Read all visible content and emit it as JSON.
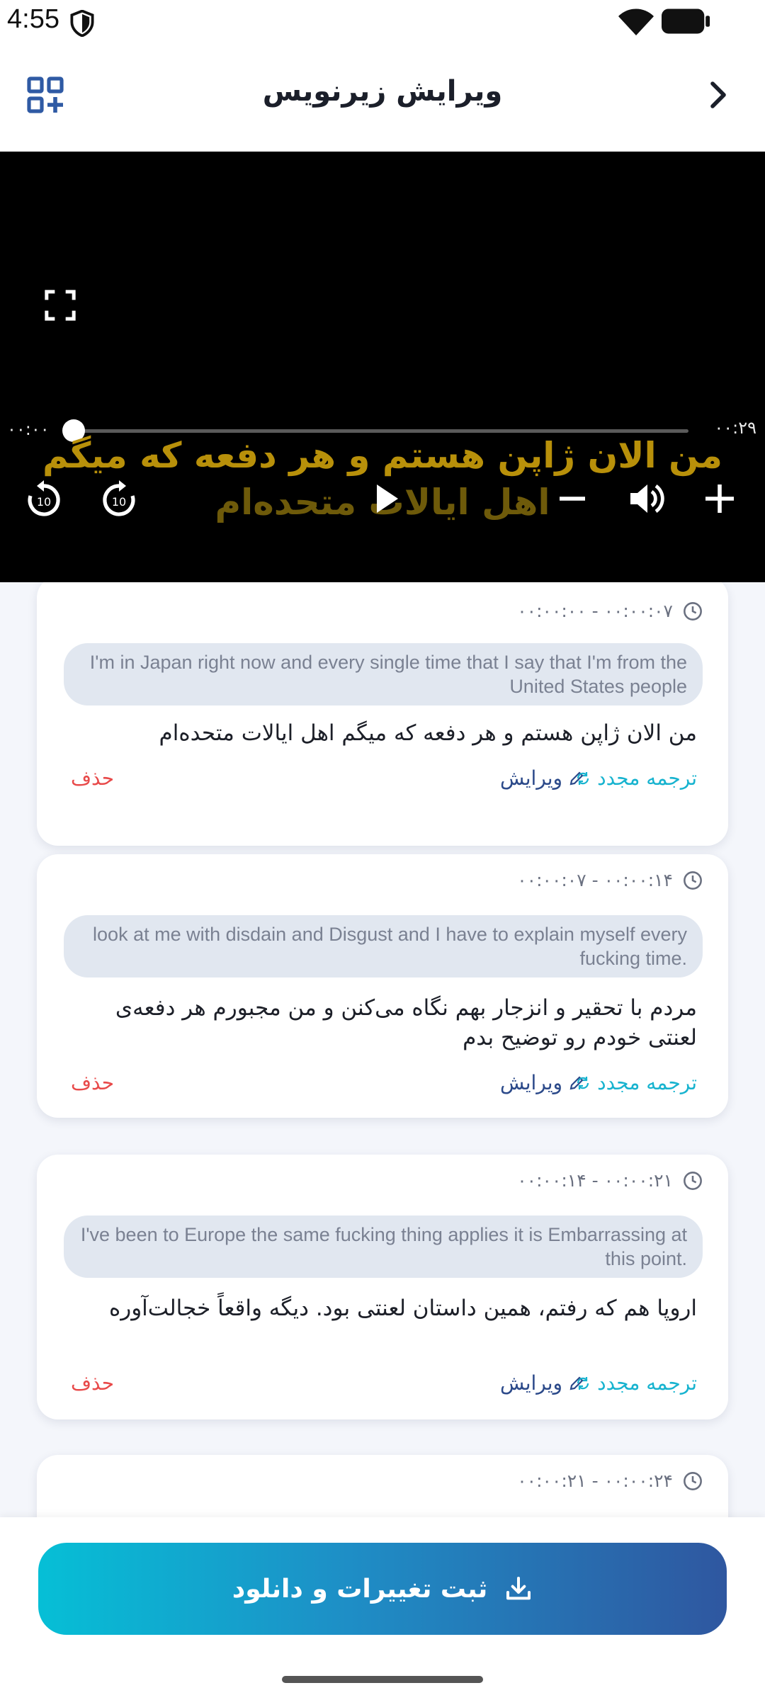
{
  "status_bar": {
    "time": "4:55"
  },
  "app_bar": {
    "title": "ویرایش زیرنویس"
  },
  "player": {
    "time_start": "۰۰:۰۰",
    "time_end": "۰۰:۲۹",
    "progress": 0.0,
    "subtitle_line1": "من الان ژاپن هستم و هر دفعه که میگم",
    "subtitle_line2": "اهل ایالات متحده‌ام"
  },
  "cards": [
    {
      "time": "۰۰:۰۰:۰۰  -  ۰۰:۰۰:۰۷",
      "source": "I'm in Japan right now and every single time that I say that I'm from the United States people",
      "translation": "من الان ژاپن هستم و هر دفعه که میگم اهل ایالات متحده‌ام"
    },
    {
      "time": "۰۰:۰۰:۰۷  -  ۰۰:۰۰:۱۴",
      "source": "look at me with disdain and Disgust and I have to explain myself every fucking time.",
      "translation": "مردم با تحقیر و انزجار بهم نگاه می‌کنن و من مجبورم هر دفعه‌ی لعنتی خودم رو توضیح بدم"
    },
    {
      "time": "۰۰:۰۰:۱۴  -  ۰۰:۰۰:۲۱",
      "source": "I've been to Europe the same fucking thing applies it is Embarrassing at this point.",
      "translation": "اروپا هم که رفتم، همین داستان لعنتی بود. دیگه واقعاً خجالت‌آوره"
    },
    {
      "time": "۰۰:۰۰:۲۱  -  ۰۰:۰۰:۲۴"
    }
  ],
  "actions": {
    "retranslate": "ترجمه مجدد",
    "edit": "ویرایش",
    "delete": "حذف"
  },
  "bottom": {
    "save_label": "ثبت تغییرات و دانلود"
  },
  "colors": {
    "accent_cyan": "#17b3cf",
    "accent_blue": "#2c4a8a",
    "delete_red": "#e84a4a",
    "subtitle_gold": "#b8900a"
  }
}
